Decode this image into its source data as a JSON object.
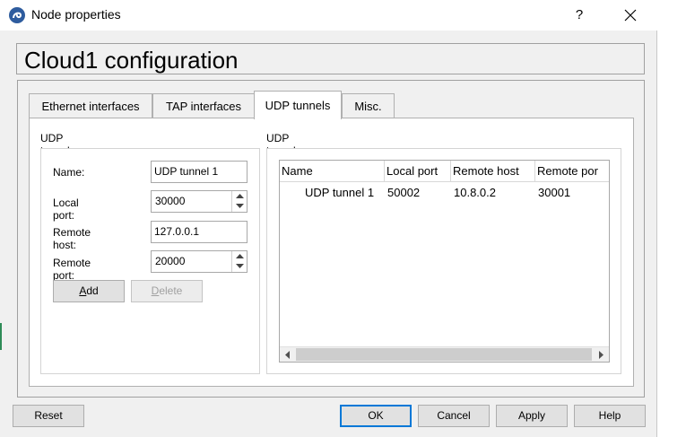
{
  "window": {
    "title": "Node properties",
    "help_label": "?",
    "heading": "Cloud1 configuration"
  },
  "tabs": [
    {
      "label": "Ethernet interfaces",
      "active": false
    },
    {
      "label": "TAP interfaces",
      "active": false
    },
    {
      "label": "UDP tunnels",
      "active": true
    },
    {
      "label": "Misc.",
      "active": false
    }
  ],
  "settings": {
    "section_title": "UDP tunnel settings",
    "name_label": "Name:",
    "name_value": "UDP tunnel 1",
    "local_port_label": "Local port:",
    "local_port_value": "30000",
    "remote_host_label": "Remote host:",
    "remote_host_value": "127.0.0.1",
    "remote_port_label": "Remote port:",
    "remote_port_value": "20000",
    "add_label": "Add",
    "delete_label": "Delete"
  },
  "tunnels": {
    "section_title": "UDP tunnels",
    "columns": [
      "Name",
      "Local port",
      "Remote host",
      "Remote por"
    ],
    "rows": [
      [
        "UDP tunnel 1",
        "50002",
        "10.8.0.2",
        "30001"
      ]
    ]
  },
  "footer": {
    "reset_label": "Reset",
    "ok_label": "OK",
    "cancel_label": "Cancel",
    "apply_label": "Apply",
    "help_label": "Help"
  },
  "icons": {
    "app": "gns3-app-icon",
    "close": "close-icon",
    "spin_up": "chevron-up-icon",
    "spin_down": "chevron-down-icon",
    "scroll_left": "scroll-left-icon",
    "scroll_right": "scroll-right-icon"
  },
  "colors": {
    "accent": "#0078d7",
    "dialog_bg": "#f0f0f0",
    "app_icon": "#2e5c9e"
  }
}
